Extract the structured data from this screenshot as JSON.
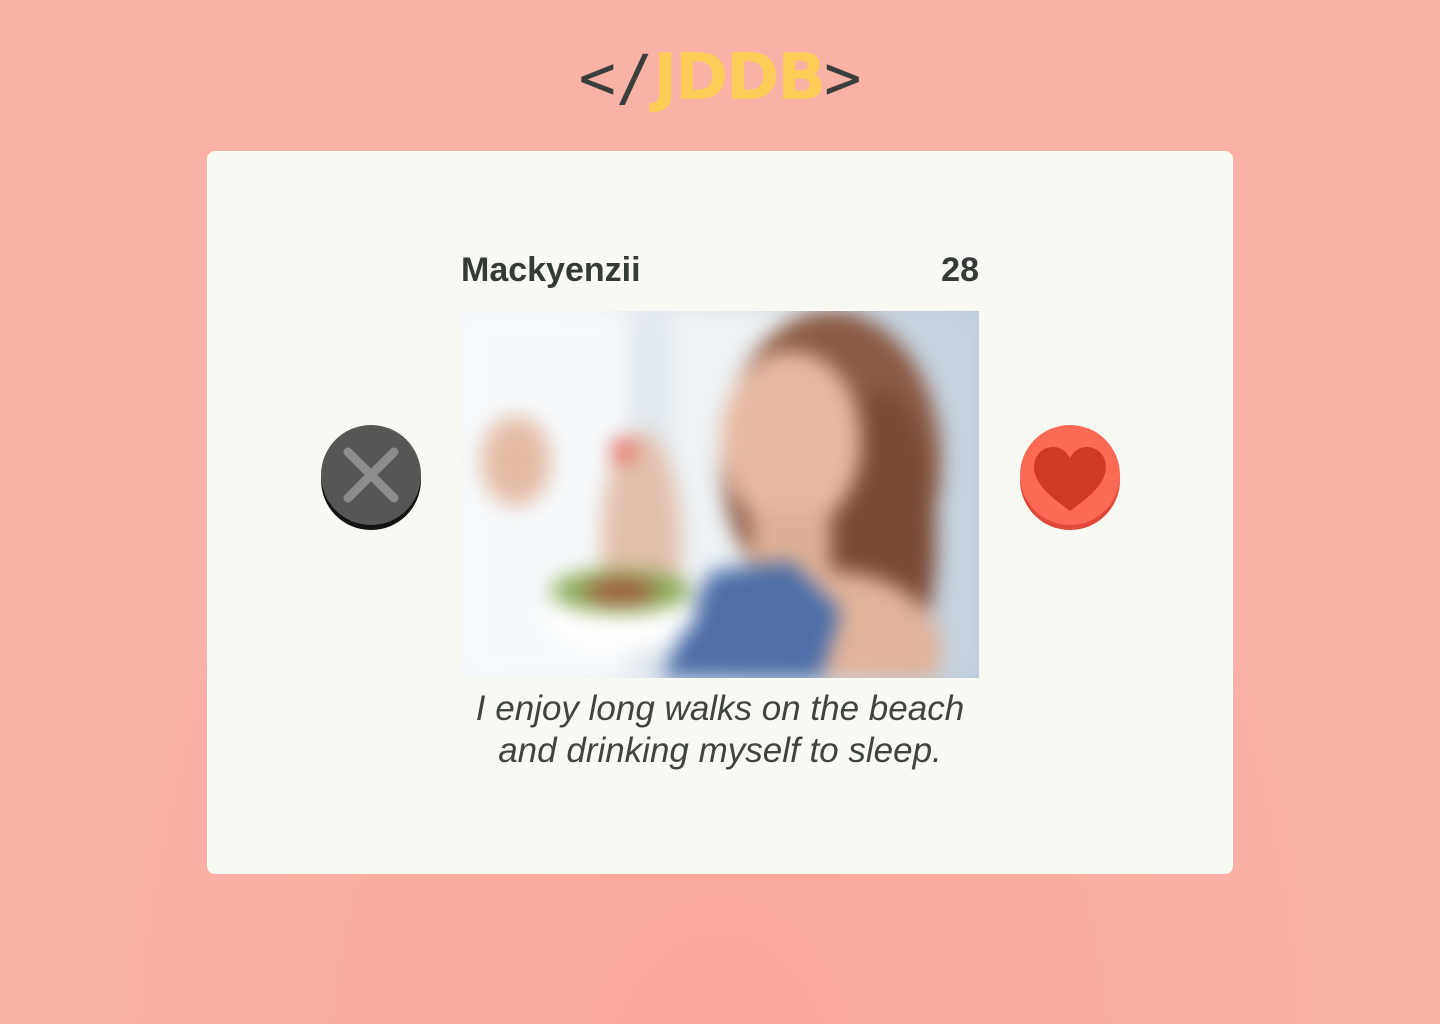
{
  "logo": {
    "open_bracket": "</",
    "brand": "JDDB",
    "close_bracket": ">"
  },
  "profile": {
    "name": "Mackyenzii",
    "age": "28",
    "bio_line1": "I enjoy long walks on the beach",
    "bio_line2": "and drinking myself to sleep.",
    "photo_icon": "profile-photo"
  },
  "actions": {
    "reject_icon": "close-icon",
    "like_icon": "heart-icon"
  },
  "colors": {
    "background": "#fab1a6",
    "card": "#f8f9f2",
    "brand": "#fecd57",
    "text_dark": "#343a36",
    "reject": "#555755",
    "like": "#fc6a55"
  }
}
